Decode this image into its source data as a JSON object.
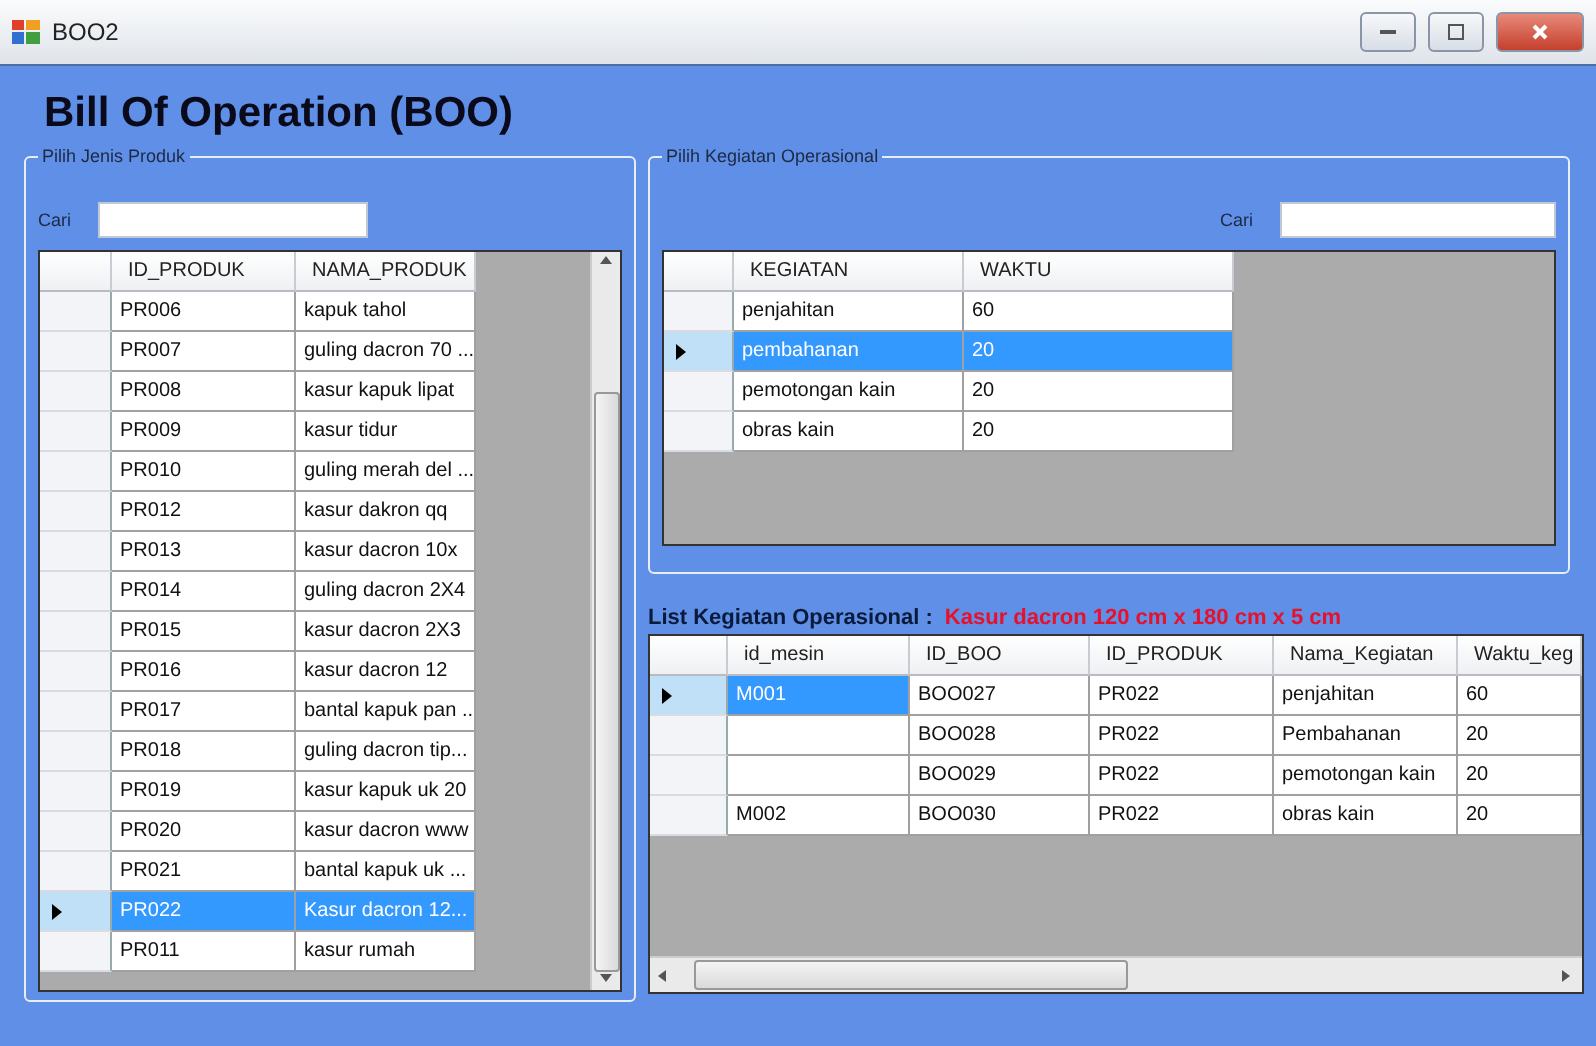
{
  "window": {
    "title": "BOO2"
  },
  "heading": "Bill Of Operation (BOO)",
  "product_panel": {
    "legend": "Pilih Jenis Produk",
    "search_label": "Cari",
    "columns": [
      "ID_PRODUK",
      "NAMA_PRODUK"
    ],
    "rows": [
      {
        "cells": [
          "PR006",
          "kapuk tahol"
        ],
        "selected": false
      },
      {
        "cells": [
          "PR007",
          "guling dacron 70 ..."
        ],
        "selected": false
      },
      {
        "cells": [
          "PR008",
          "kasur kapuk lipat"
        ],
        "selected": false
      },
      {
        "cells": [
          "PR009",
          "kasur tidur"
        ],
        "selected": false
      },
      {
        "cells": [
          "PR010",
          "guling merah del ..."
        ],
        "selected": false
      },
      {
        "cells": [
          "PR012",
          "kasur dakron qq"
        ],
        "selected": false
      },
      {
        "cells": [
          "PR013",
          "kasur dacron 10x"
        ],
        "selected": false
      },
      {
        "cells": [
          "PR014",
          "guling dacron 2X4"
        ],
        "selected": false
      },
      {
        "cells": [
          "PR015",
          "kasur dacron 2X3"
        ],
        "selected": false
      },
      {
        "cells": [
          "PR016",
          "kasur dacron 12"
        ],
        "selected": false
      },
      {
        "cells": [
          "PR017",
          "bantal kapuk pan ..."
        ],
        "selected": false
      },
      {
        "cells": [
          "PR018",
          "guling dacron tip..."
        ],
        "selected": false
      },
      {
        "cells": [
          "PR019",
          "kasur kapuk uk 20"
        ],
        "selected": false
      },
      {
        "cells": [
          "PR020",
          "kasur dacron www"
        ],
        "selected": false
      },
      {
        "cells": [
          "PR021",
          "bantal kapuk uk ..."
        ],
        "selected": false
      },
      {
        "cells": [
          "PR022",
          "Kasur dacron 12..."
        ],
        "selected": true
      },
      {
        "cells": [
          "PR011",
          "kasur rumah"
        ],
        "selected": false
      }
    ]
  },
  "activity_panel": {
    "legend": "Pilih Kegiatan Operasional",
    "search_label": "Cari",
    "columns": [
      "KEGIATAN",
      "WAKTU"
    ],
    "rows": [
      {
        "cells": [
          "penjahitan",
          "60"
        ],
        "selected": false
      },
      {
        "cells": [
          "pembahanan",
          "20"
        ],
        "selected": true
      },
      {
        "cells": [
          "pemotongan kain",
          "20"
        ],
        "selected": false
      },
      {
        "cells": [
          "obras kain",
          "20"
        ],
        "selected": false
      }
    ]
  },
  "list_section": {
    "label": "List Kegiatan Operasional :",
    "product": "Kasur dacron 120 cm x 180 cm x 5 cm",
    "columns": [
      "id_mesin",
      "ID_BOO",
      "ID_PRODUK",
      "Nama_Kegiatan",
      "Waktu_keg"
    ],
    "rows": [
      {
        "cells": [
          "M001",
          "BOO027",
          "PR022",
          "penjahitan",
          "60"
        ],
        "selected": true
      },
      {
        "cells": [
          "",
          "BOO028",
          "PR022",
          "Pembahanan",
          "20"
        ],
        "selected": false
      },
      {
        "cells": [
          "",
          "BOO029",
          "PR022",
          "pemotongan kain",
          "20"
        ],
        "selected": false
      },
      {
        "cells": [
          "M002",
          "BOO030",
          "PR022",
          "obras kain",
          "20"
        ],
        "selected": false
      }
    ]
  }
}
